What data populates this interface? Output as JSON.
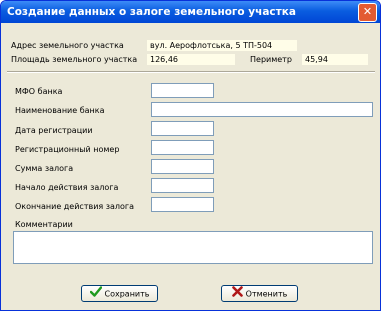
{
  "window": {
    "title": "Создание данных о залоге земельного участка",
    "close_glyph": "✕"
  },
  "info": {
    "address_label": "Адрес земельного участка",
    "address_value": "вул. Аерофлотська, 5 ТП-504",
    "area_label": "Площадь земельного участка",
    "area_value": "126,46",
    "perimeter_label": "Периметр",
    "perimeter_value": "45,94"
  },
  "form": {
    "mfo_label": "МФО банка",
    "mfo_value": "",
    "bank_name_label": "Наименование банка",
    "bank_name_value": "",
    "reg_date_label": "Дата регистрации",
    "reg_date_value": "",
    "reg_number_label": "Регистрационный номер",
    "reg_number_value": "",
    "amount_label": "Сумма залога",
    "amount_value": "",
    "start_label": "Начало действия залога",
    "start_value": "",
    "end_label": "Окончание действия залога",
    "end_value": "",
    "comments_label": "Комментарии",
    "comments_value": ""
  },
  "buttons": {
    "save_label": "Сохранить",
    "cancel_label": "Отменить"
  },
  "icons": {
    "save": "check-icon",
    "cancel": "x-icon"
  },
  "colors": {
    "title_bar": "#0a5de0",
    "save_icon": "#1e9a1e",
    "cancel_icon": "#b01818",
    "readonly_bg": "#fffde8"
  }
}
